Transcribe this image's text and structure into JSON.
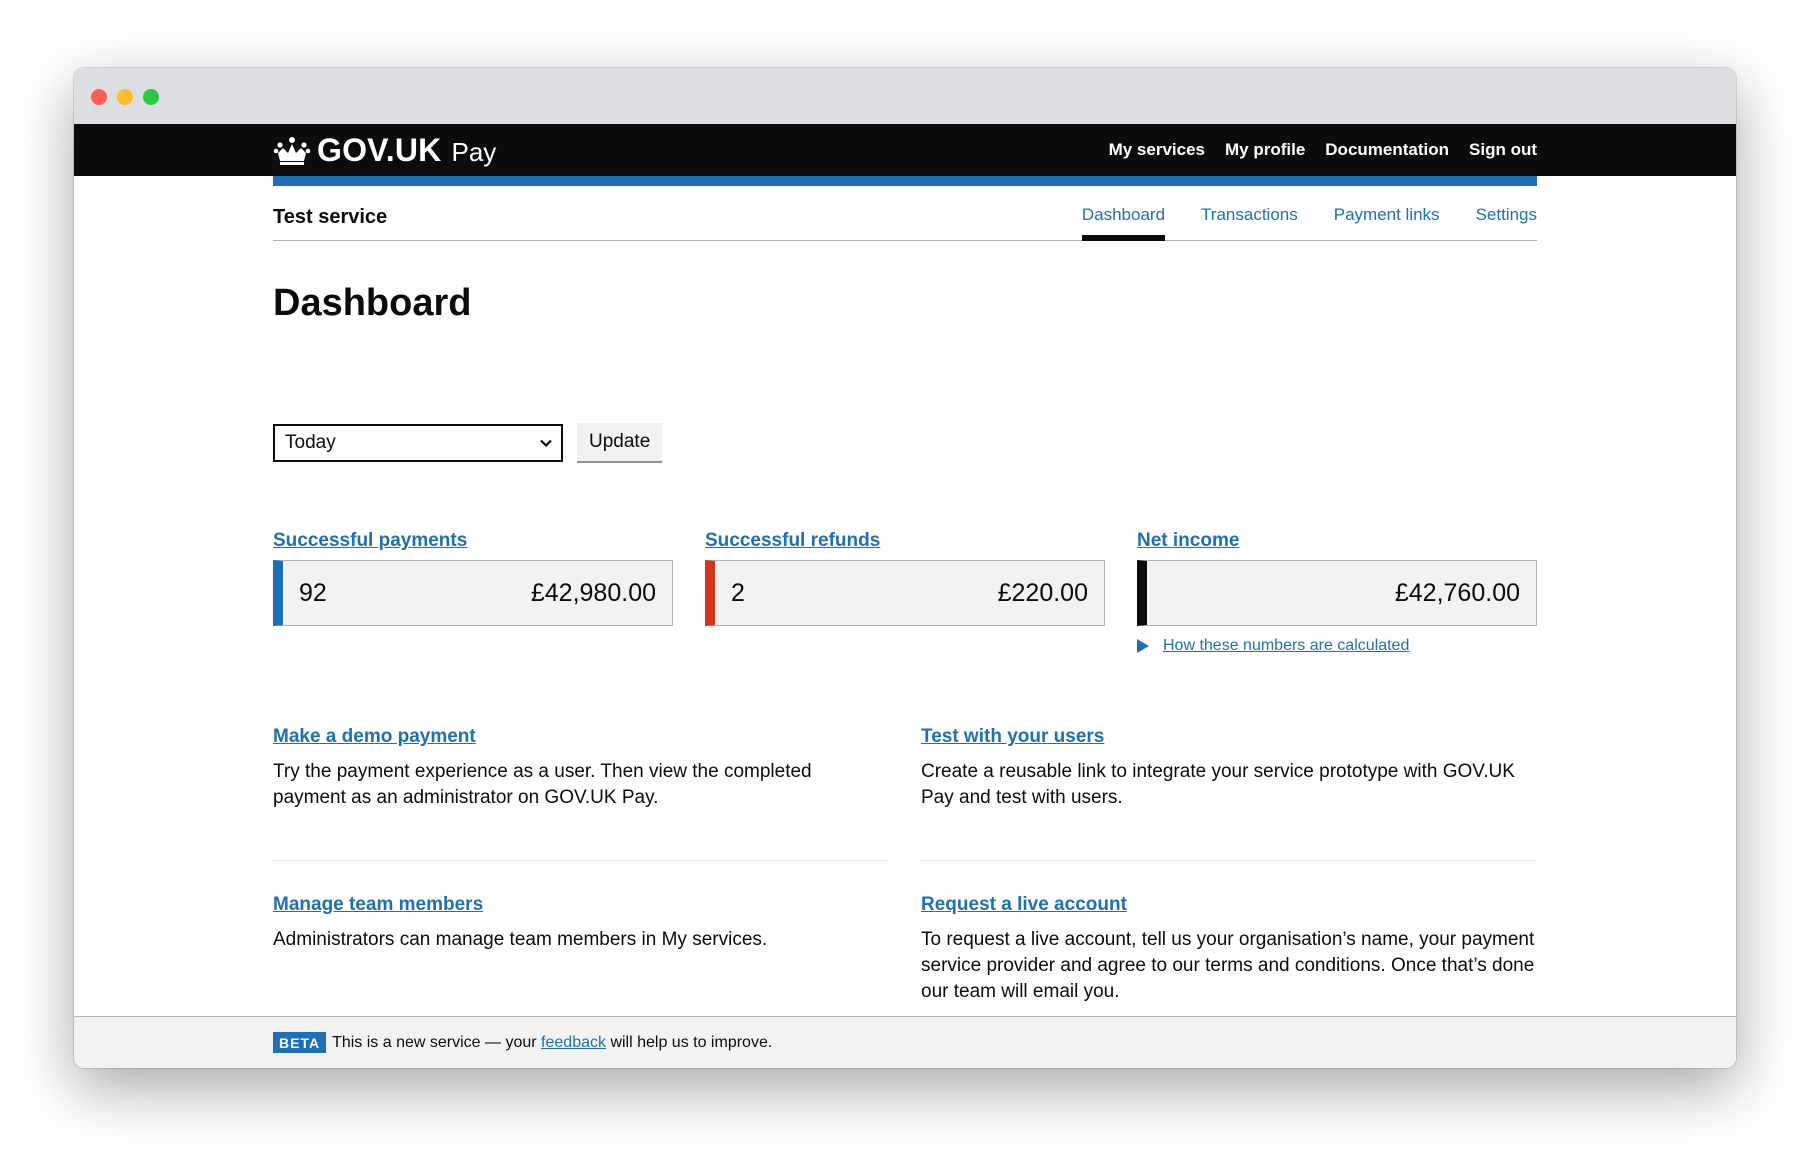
{
  "window": {
    "controls": [
      "close",
      "minimize",
      "maximize"
    ]
  },
  "header": {
    "logo_icon": "crown-icon",
    "brand": "GOV.UK",
    "product": "Pay",
    "nav": [
      {
        "label": "My services"
      },
      {
        "label": "My profile"
      },
      {
        "label": "Documentation"
      },
      {
        "label": "Sign out"
      }
    ]
  },
  "subnav": {
    "service_name": "Test service",
    "tabs": [
      {
        "label": "Dashboard",
        "active": true
      },
      {
        "label": "Transactions",
        "active": false
      },
      {
        "label": "Payment links",
        "active": false
      },
      {
        "label": "Settings",
        "active": false
      }
    ]
  },
  "page": {
    "title": "Dashboard",
    "period_select": {
      "value": "Today"
    },
    "update_label": "Update"
  },
  "stats": {
    "payments": {
      "label": "Successful payments",
      "count": "92",
      "amount": "£42,980.00",
      "color": "#1d70b8"
    },
    "refunds": {
      "label": "Successful refunds",
      "count": "2",
      "amount": "£220.00",
      "color": "#d4351c"
    },
    "net": {
      "label": "Net income",
      "amount": "£42,760.00",
      "color": "#0b0c0c"
    },
    "details_link": "How these numbers are calculated"
  },
  "cards": [
    {
      "title": "Make a demo payment",
      "body": "Try the payment experience as a user. Then view the completed payment as an administrator on GOV.UK Pay."
    },
    {
      "title": "Test with your users",
      "body": "Create a reusable link to integrate your service prototype with GOV.UK Pay and test with users."
    },
    {
      "title": "Manage team members",
      "body": "Administrators can manage team members in My services."
    },
    {
      "title": "Request a live account",
      "body": "To request a live account, tell us your organisation’s name, your payment service provider and agree to our terms and conditions. Once that’s done our team will email you."
    }
  ],
  "footer": {
    "beta_tag": "BETA",
    "text_before": "This is a new service — your",
    "link": "feedback",
    "text_after": "will help us to improve."
  },
  "colors": {
    "brand_black": "#0b0c0c",
    "link_blue": "#1d70b8",
    "refund_red": "#d4351c",
    "panel_grey": "#f3f2f1"
  }
}
